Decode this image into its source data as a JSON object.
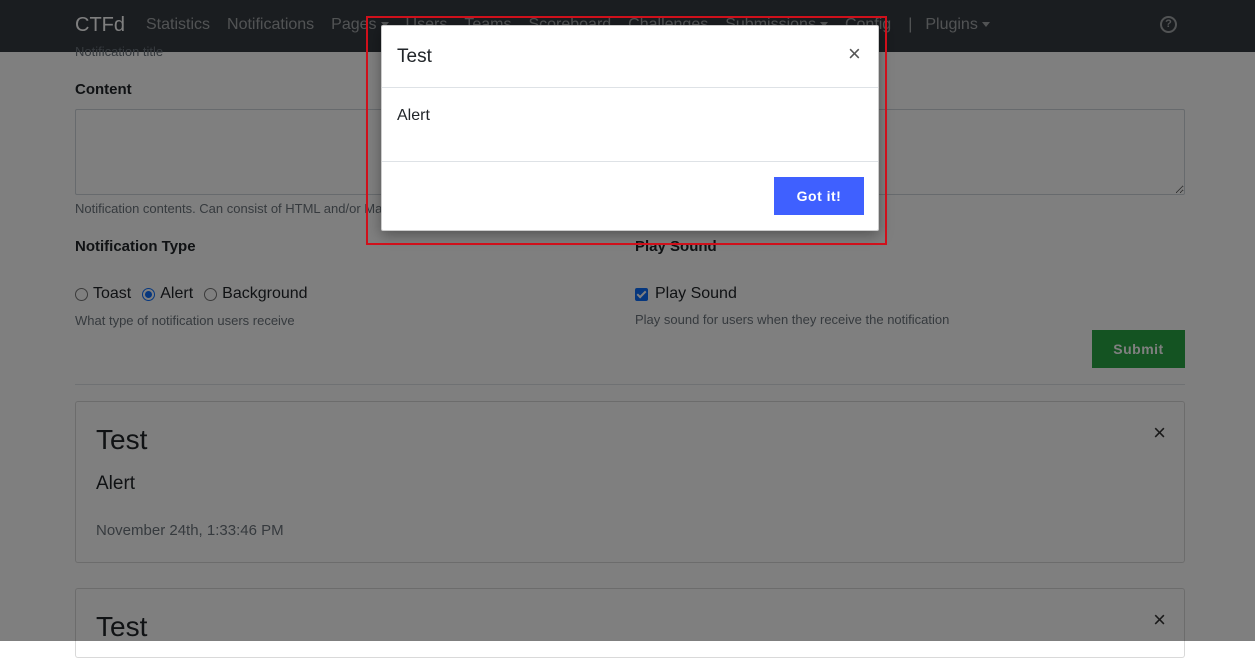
{
  "navbar": {
    "brand": "CTFd",
    "items": [
      {
        "label": "Statistics",
        "dropdown": false
      },
      {
        "label": "Notifications",
        "dropdown": false
      },
      {
        "label": "Pages",
        "dropdown": true
      },
      {
        "label": "Users",
        "dropdown": false
      },
      {
        "label": "Teams",
        "dropdown": false
      },
      {
        "label": "Scoreboard",
        "dropdown": false
      },
      {
        "label": "Challenges",
        "dropdown": false
      },
      {
        "label": "Submissions",
        "dropdown": true
      },
      {
        "label": "Config",
        "dropdown": false
      }
    ],
    "separator": "|",
    "plugins_label": "Plugins",
    "help_icon": "question-circle-icon"
  },
  "form": {
    "title_help": "Notification title",
    "content_label": "Content",
    "content_value": "",
    "content_help": "Notification contents. Can consist of HTML and/or Markdown.",
    "type_label": "Notification Type",
    "type_options": [
      {
        "label": "Toast",
        "checked": false
      },
      {
        "label": "Alert",
        "checked": true
      },
      {
        "label": "Background",
        "checked": false
      }
    ],
    "type_help": "What type of notification users receive",
    "sound_label": "Play Sound",
    "sound_checkbox_label": "Play Sound",
    "sound_checked": true,
    "sound_help": "Play sound for users when they receive the notification",
    "submit_label": "Submit"
  },
  "notifications": [
    {
      "title": "Test",
      "body": "Alert",
      "date": "November 24th, 1:33:46 PM",
      "close": "×"
    },
    {
      "title": "Test",
      "body": "",
      "date": "",
      "close": "×"
    }
  ],
  "modal": {
    "title": "Test",
    "body": "Alert",
    "button_label": "Got it!",
    "close": "×"
  },
  "colors": {
    "navbar": "#343a40",
    "submit": "#28a745",
    "primary": "#3f60ff",
    "highlight": "#d0101b"
  }
}
